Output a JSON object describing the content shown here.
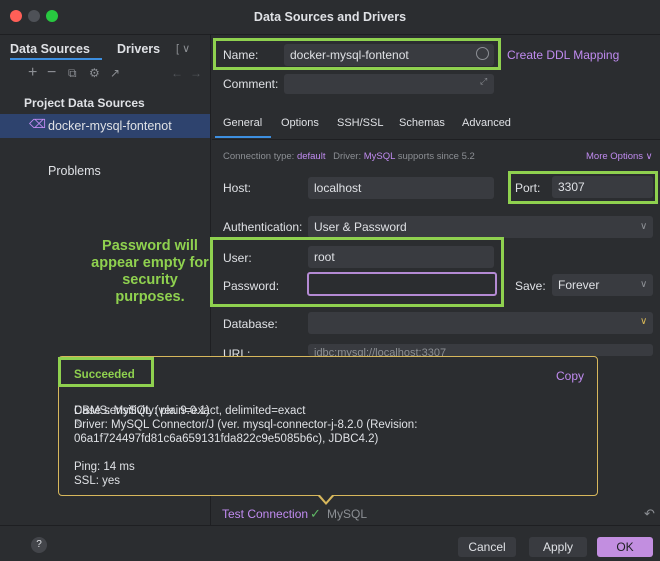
{
  "window": {
    "title": "Data Sources and Drivers"
  },
  "left": {
    "tabs": [
      "Data Sources",
      "Drivers",
      "[ ∨"
    ],
    "section_title": "Project Data Sources",
    "selected_item": "docker-mysql-fontenot",
    "problems_label": "Problems"
  },
  "annotation": {
    "text": "Password will appear empty for security purposes."
  },
  "form": {
    "name_label": "Name:",
    "name_value": "docker-mysql-fontenot",
    "create_ddl": "Create DDL Mapping",
    "comment_label": "Comment:",
    "tabs": [
      "General",
      "Options",
      "SSH/SSL",
      "Schemas",
      "Advanced"
    ],
    "conn_type_label": "Connection type:",
    "conn_type_value": "default",
    "driver_label": "Driver:",
    "driver_value": "MySQL",
    "driver_note": "supports since 5.2",
    "more_options": "More Options ∨",
    "host_label": "Host:",
    "host_value": "localhost",
    "port_label": "Port:",
    "port_value": "3307",
    "auth_label": "Authentication:",
    "auth_value": "User & Password",
    "user_label": "User:",
    "user_value": "root",
    "password_label": "Password:",
    "save_label": "Save:",
    "save_value": "Forever",
    "database_label": "Database:",
    "url_label": "URL:",
    "url_value": "jdbc:mysql://localhost:3307"
  },
  "popup": {
    "status": "Succeeded",
    "copy": "Copy",
    "dbms": "DBMS: MySQL (ver. 9.0.1)",
    "body": "Case sensitivity: plain=exact, delimited=exact\nDriver: MySQL Connector/J (ver. mysql-connector-j-8.2.0 (Revision:\n06a1f724497fd81c6a659131fda822c9e5085b6c), JDBC4.2)\n\nPing: 14 ms\nSSL: yes"
  },
  "footer": {
    "test_connection": "Test Connection",
    "check_mark": "✓",
    "driver_name": "MySQL",
    "help": "?",
    "cancel": "Cancel",
    "apply": "Apply",
    "ok": "OK"
  },
  "colors": {
    "accent_green": "#8fd14f",
    "primary_button": "#c28ee0",
    "link": "#c08bf0"
  }
}
